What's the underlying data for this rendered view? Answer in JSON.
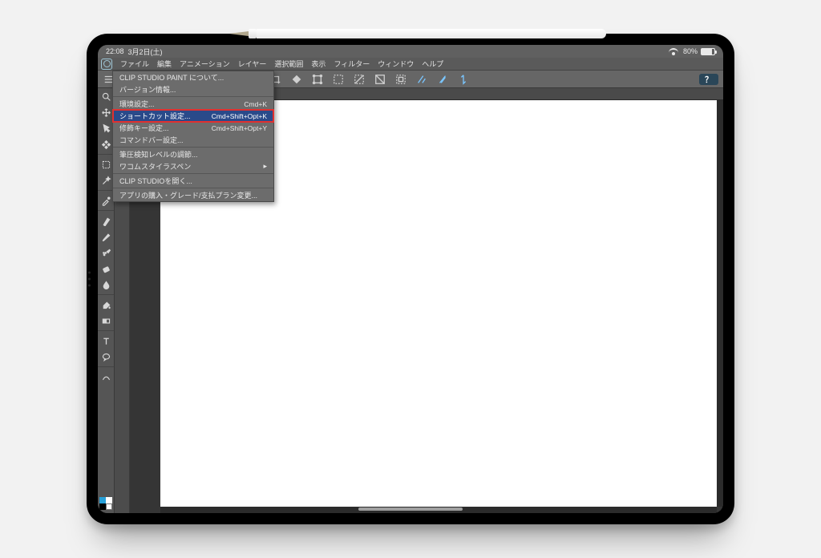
{
  "status": {
    "time": "22:08",
    "date": "3月2日(土)",
    "battery": "80%"
  },
  "menubar": [
    "ファイル",
    "編集",
    "アニメーション",
    "レイヤー",
    "選択範囲",
    "表示",
    "フィルター",
    "ウィンドウ",
    "ヘルプ"
  ],
  "help_icon": "？",
  "dropdown": {
    "group1": [
      {
        "label": "CLIP STUDIO PAINT について..."
      },
      {
        "label": "バージョン情報..."
      }
    ],
    "group2": [
      {
        "label": "環境設定...",
        "shortcut": "Cmd+K"
      },
      {
        "label": "ショートカット設定...",
        "shortcut": "Cmd+Shift+Opt+K",
        "highlight": true
      },
      {
        "label": "修飾キー設定...",
        "shortcut": "Cmd+Shift+Opt+Y"
      },
      {
        "label": "コマンドバー設定..."
      }
    ],
    "group3": [
      {
        "label": "筆圧検知レベルの調節..."
      },
      {
        "label": "ワコムスタイラスペン",
        "submenu": true
      }
    ],
    "group4": [
      {
        "label": "CLIP STUDIOを開く..."
      }
    ],
    "group5": [
      {
        "label": "アプリの購入・グレード/支払プラン変更..."
      }
    ]
  },
  "colors": {
    "fg": "#28a0d8",
    "bg": "#ffffff",
    "a": "#000000",
    "b": "#ffffff"
  }
}
